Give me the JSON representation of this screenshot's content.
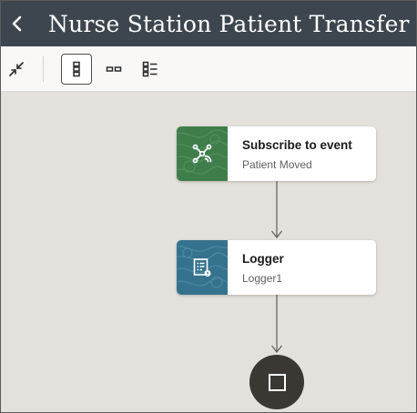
{
  "header": {
    "title": "Nurse Station Patient Transfer",
    "back_icon": "chevron-left-icon"
  },
  "toolbar": {
    "tools": [
      {
        "icon": "collapse-icon",
        "selected": false
      },
      {
        "icon": "vertical-layout-icon",
        "selected": true
      },
      {
        "icon": "horizontal-layout-icon",
        "selected": false
      },
      {
        "icon": "list-layout-icon",
        "selected": false
      }
    ]
  },
  "flow": {
    "nodes": [
      {
        "title": "Subscribe to event",
        "subtitle": "Patient Moved",
        "icon": "event-subscribe-icon",
        "color": "#3f7d4b"
      },
      {
        "title": "Logger",
        "subtitle": "Logger1",
        "icon": "logger-icon",
        "color": "#35728d"
      }
    ],
    "end_icon": "stop-icon"
  }
}
